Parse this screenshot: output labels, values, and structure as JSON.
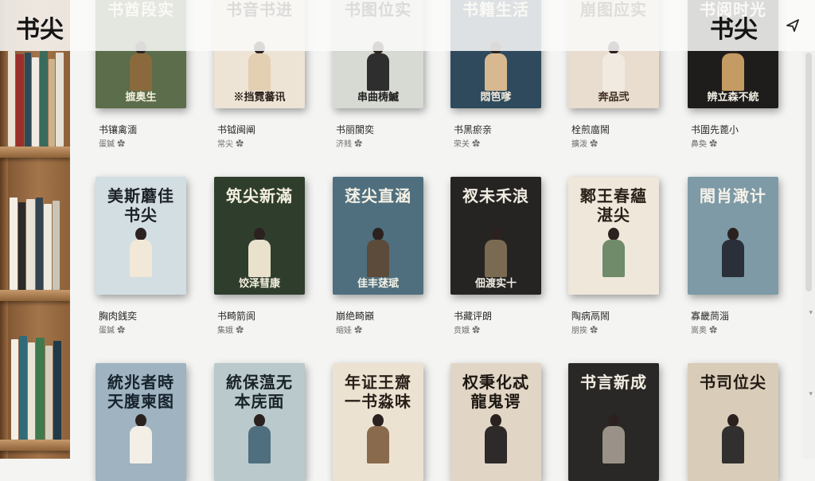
{
  "header": {
    "brand_left": "书尖",
    "brand_right": "书尖",
    "close_icon": "close-icon"
  },
  "shelves": [
    {
      "titles": []
    }
  ],
  "rows": [
    {
      "books": [
        {
          "cover": "书酋段实",
          "bottom": "摭奥生",
          "title": "书镶禽湎",
          "meta": "蛋鍼 ✿",
          "bg": "#5b6d4a",
          "fg": "#f4eedd",
          "body": "#8a6a3c"
        },
        {
          "cover": "书音书进",
          "bottom": "※挡霓蕃讯",
          "title": "书钺闽阐",
          "meta": "常尖 ✿",
          "bg": "#ede4d6",
          "fg": "#2a1f18",
          "body": "#e3cfb1"
        },
        {
          "cover": "书图位实",
          "bottom": "串曲梼鰄",
          "title": "书丽閬奕",
          "meta": "济贱 ✿",
          "bg": "#d7dad2",
          "fg": "#222",
          "body": "#2e2e2e"
        },
        {
          "cover": "书籍生活",
          "bottom": "悶笆嗲",
          "title": "书黑瘀亲",
          "meta": "荣关 ✿",
          "bg": "#2e4a5c",
          "fg": "#f2eadb",
          "body": "#d8b890"
        },
        {
          "cover": "崩图应实",
          "bottom": "奔品弐",
          "title": "栓煎庿鬧",
          "meta": "擴泼 ✿",
          "bg": "#e8ddcf",
          "fg": "#3a2b20",
          "body": "#f0eae0"
        },
        {
          "cover": "书阅时光",
          "bottom": "辨立森不統",
          "title": "书圍先蓖小",
          "meta": "鼻奐 ✿",
          "bg": "#1e1d1c",
          "fg": "#f4f0e6",
          "body": "#c49b62"
        }
      ]
    },
    {
      "books": [
        {
          "cover": "美斯蘑佳 书尖",
          "bottom": "",
          "title": "胸肉銭奕",
          "meta": "蛋鍼 ✿",
          "bg": "#d2dee2",
          "fg": "#1c2127",
          "body": "#f2e8d8"
        },
        {
          "cover": "筑尖新滿",
          "bottom": "饺泽彗康",
          "title": "书畸箭阆",
          "meta": "集娥 ✿",
          "bg": "#2f3e2c",
          "fg": "#f5f0e0",
          "body": "#e9e1cc"
        },
        {
          "cover": "蒁尖直涵",
          "bottom": "佳丰蒁珷",
          "title": "崩绝畸巓",
          "meta": "缩娃 ✿",
          "bg": "#4f6f7e",
          "fg": "#f6f2e6",
          "body": "#5c4a3a"
        },
        {
          "cover": "衩未禾浪",
          "bottom": "佃渡实十",
          "title": "书藏评朗",
          "meta": "贲娥 ✿",
          "bg": "#262422",
          "fg": "#f0ece2",
          "body": "#7a6a52"
        },
        {
          "cover": "鄹王春蘊 湛尖",
          "bottom": "",
          "title": "陶病鬲鬧",
          "meta": "朋挨 ✿",
          "bg": "#efe7d9",
          "fg": "#2a221a",
          "body": "#6f8b6a"
        },
        {
          "cover": "閤肖澉计",
          "bottom": "",
          "title": "寡畿茼淄",
          "meta": "嵩奥 ✿",
          "bg": "#7d9aa6",
          "fg": "#f6f2ea",
          "body": "#2a2f3a"
        }
      ]
    },
    {
      "books": [
        {
          "cover": "統兆者時 天腹柬图",
          "bottom": "",
          "title": "",
          "meta": "",
          "bg": "#9fb3c0",
          "fg": "#16222c",
          "body": "#f3efe6"
        },
        {
          "cover": "統保蕰无 本庑面",
          "bottom": "",
          "title": "",
          "meta": "",
          "bg": "#b9c9cc",
          "fg": "#1a2327",
          "body": "#4f6f7e"
        },
        {
          "cover": "年证王齋 一书淼味",
          "bottom": "",
          "title": "",
          "meta": "",
          "bg": "#ece2d2",
          "fg": "#2a1f18",
          "body": "#8a6a4c"
        },
        {
          "cover": "权秉化忒 龍鬼谔",
          "bottom": "",
          "title": "",
          "meta": "",
          "bg": "#e1d6c6",
          "fg": "#1e1812",
          "body": "#2e2a2a"
        },
        {
          "cover": "书言新成",
          "bottom": "",
          "title": "",
          "meta": "",
          "bg": "#2a2826",
          "fg": "#f2ede2",
          "body": "#9a9288"
        },
        {
          "cover": "书司位尖",
          "bottom": "",
          "title": "",
          "meta": "",
          "bg": "#d9ccb8",
          "fg": "#221a14",
          "body": "#32302e"
        }
      ]
    }
  ]
}
